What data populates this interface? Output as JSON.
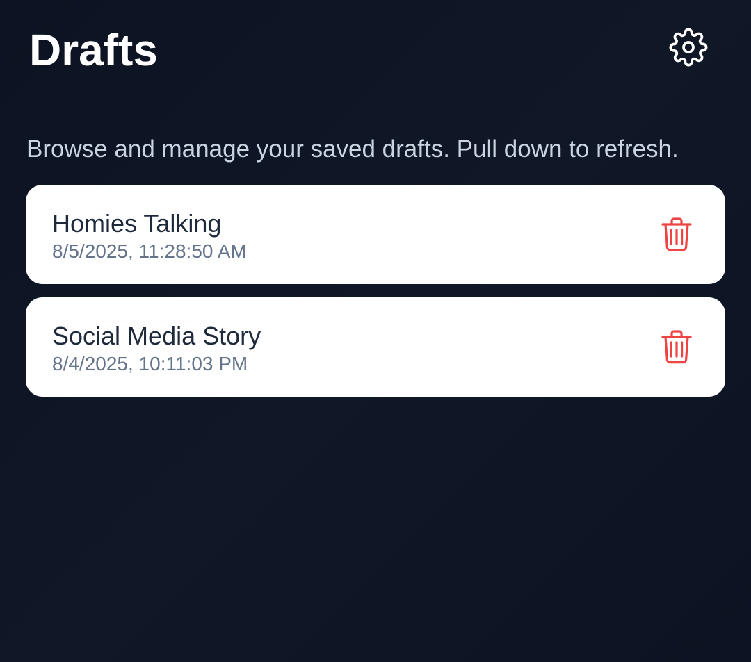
{
  "header": {
    "title": "Drafts",
    "settings_icon": "gear-icon"
  },
  "subtitle": "Browse and manage your saved drafts. Pull down to refresh.",
  "drafts": [
    {
      "title": "Homies Talking",
      "date": "8/5/2025, 11:28:50 AM",
      "delete_icon": "trash-icon"
    },
    {
      "title": "Social Media Story",
      "date": "8/4/2025, 10:11:03 PM",
      "delete_icon": "trash-icon"
    }
  ],
  "colors": {
    "background": "#0c1322",
    "card": "#ffffff",
    "title_text": "#1e293b",
    "date_text": "#64748b",
    "subtitle_text": "#cbd5e1",
    "delete_accent": "#ef4444"
  }
}
